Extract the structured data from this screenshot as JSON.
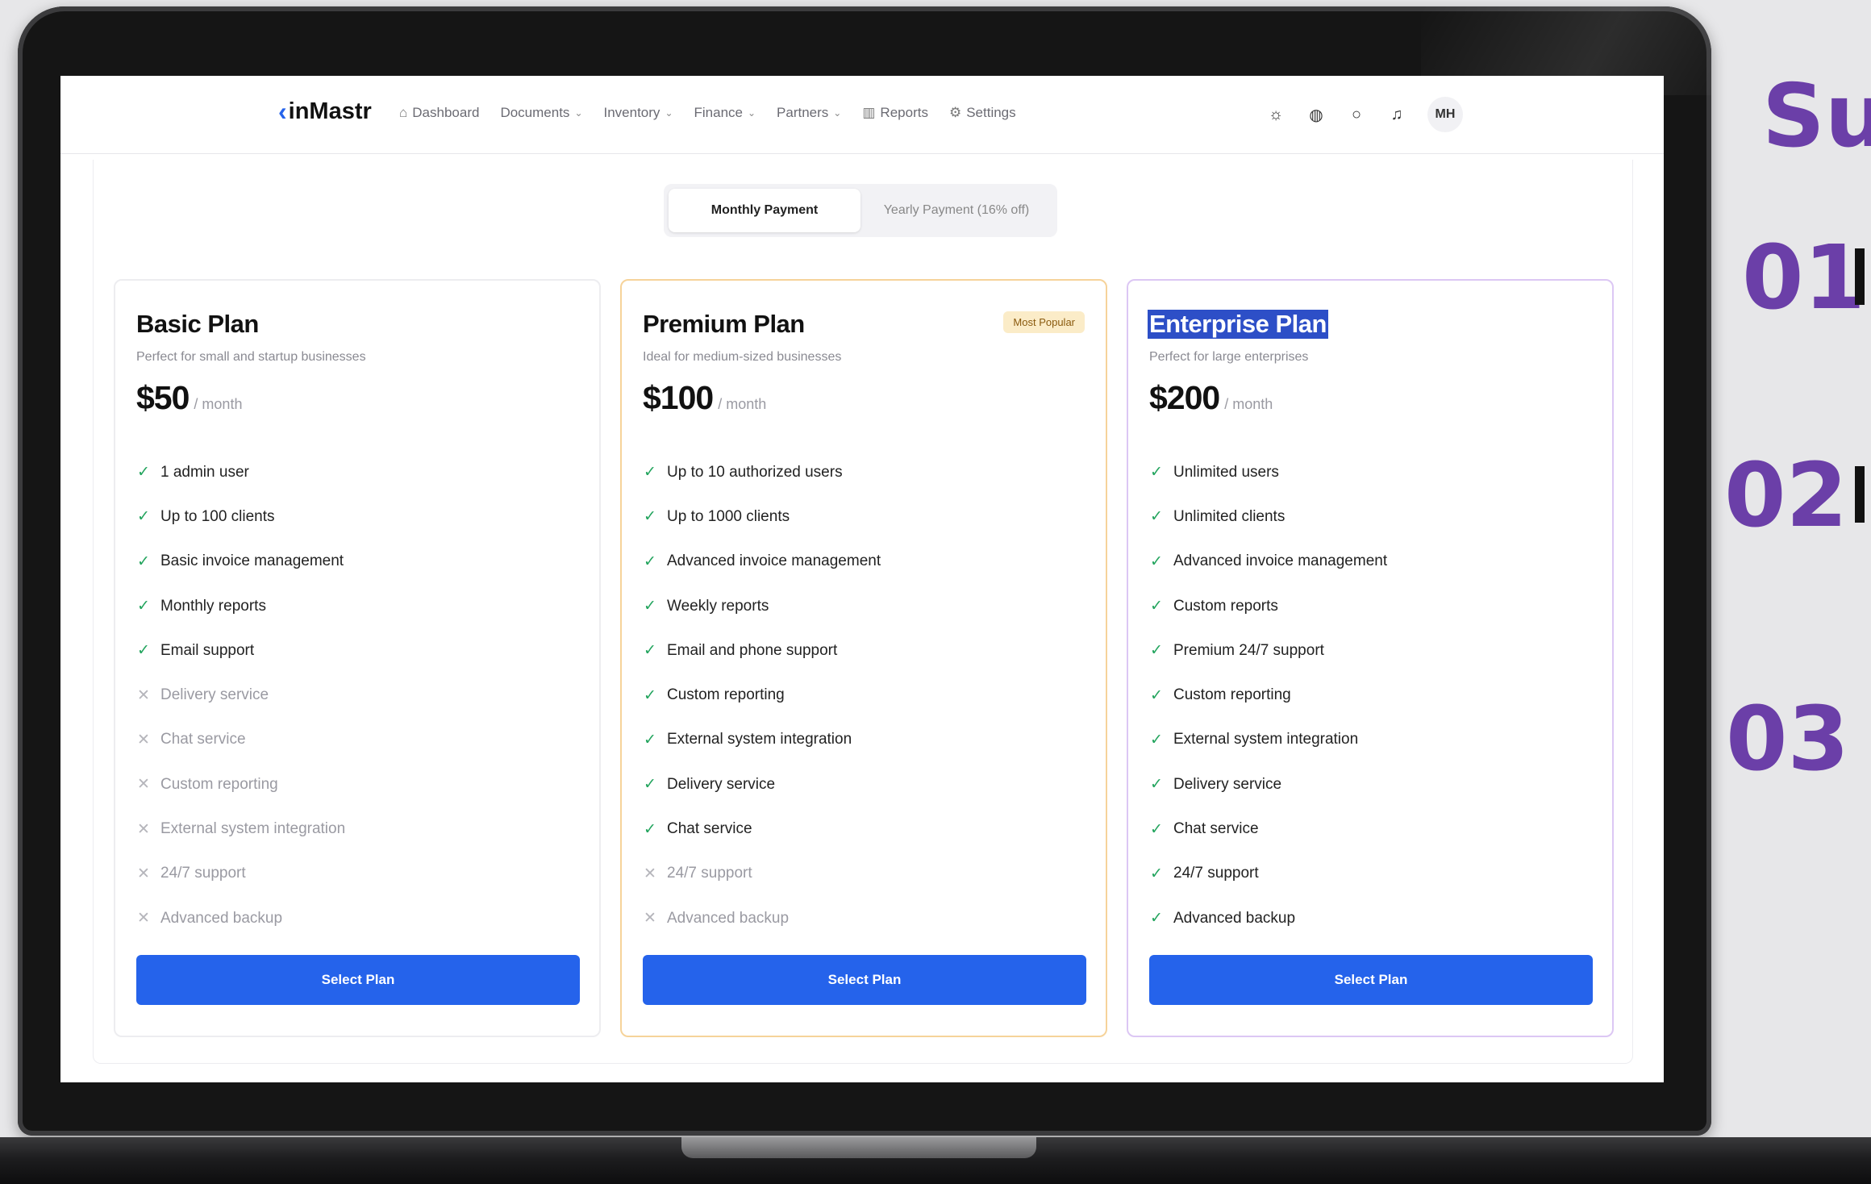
{
  "navbar": {
    "logo": "inMastr",
    "items": [
      {
        "label": "Dashboard",
        "icon": "home-icon",
        "dropdown": false
      },
      {
        "label": "Documents",
        "icon": "",
        "dropdown": true
      },
      {
        "label": "Inventory",
        "icon": "",
        "dropdown": true
      },
      {
        "label": "Finance",
        "icon": "",
        "dropdown": true
      },
      {
        "label": "Partners",
        "icon": "",
        "dropdown": true
      },
      {
        "label": "Reports",
        "icon": "chart-icon",
        "dropdown": false
      },
      {
        "label": "Settings",
        "icon": "gear-icon",
        "dropdown": false
      }
    ],
    "right_icons": [
      "theme-toggle-icon",
      "globe-icon",
      "chat-icon",
      "bell-icon"
    ],
    "avatar_initials": "MH"
  },
  "billing_toggle": {
    "monthly": "Monthly Payment",
    "yearly": "Yearly Payment (16% off)",
    "active": "monthly"
  },
  "plans": [
    {
      "name": "Basic Plan",
      "subtitle": "Perfect for small and startup businesses",
      "price": "$50",
      "period": "/ month",
      "badge": "",
      "features": [
        {
          "text": "1 admin user",
          "included": true
        },
        {
          "text": "Up to 100 clients",
          "included": true
        },
        {
          "text": "Basic invoice management",
          "included": true
        },
        {
          "text": "Monthly reports",
          "included": true
        },
        {
          "text": "Email support",
          "included": true
        },
        {
          "text": "Delivery service",
          "included": false
        },
        {
          "text": "Chat service",
          "included": false
        },
        {
          "text": "Custom reporting",
          "included": false
        },
        {
          "text": "External system integration",
          "included": false
        },
        {
          "text": "24/7 support",
          "included": false
        },
        {
          "text": "Advanced backup",
          "included": false
        }
      ],
      "button": "Select Plan"
    },
    {
      "name": "Premium Plan",
      "subtitle": "Ideal for medium-sized businesses",
      "price": "$100",
      "period": "/ month",
      "badge": "Most Popular",
      "features": [
        {
          "text": "Up to 10 authorized users",
          "included": true
        },
        {
          "text": "Up to 1000 clients",
          "included": true
        },
        {
          "text": "Advanced invoice management",
          "included": true
        },
        {
          "text": "Weekly reports",
          "included": true
        },
        {
          "text": "Email and phone support",
          "included": true
        },
        {
          "text": "Custom reporting",
          "included": true
        },
        {
          "text": "External system integration",
          "included": true
        },
        {
          "text": "Delivery service",
          "included": true
        },
        {
          "text": "Chat service",
          "included": true
        },
        {
          "text": "24/7 support",
          "included": false
        },
        {
          "text": "Advanced backup",
          "included": false
        }
      ],
      "button": "Select Plan"
    },
    {
      "name": "Enterprise Plan",
      "subtitle": "Perfect for large enterprises",
      "price": "$200",
      "period": "/ month",
      "badge": "",
      "features": [
        {
          "text": "Unlimited users",
          "included": true
        },
        {
          "text": "Unlimited clients",
          "included": true
        },
        {
          "text": "Advanced invoice management",
          "included": true
        },
        {
          "text": "Custom reports",
          "included": true
        },
        {
          "text": "Premium 24/7 support",
          "included": true
        },
        {
          "text": "Custom reporting",
          "included": true
        },
        {
          "text": "External system integration",
          "included": true
        },
        {
          "text": "Delivery service",
          "included": true
        },
        {
          "text": "Chat service",
          "included": true
        },
        {
          "text": "24/7 support",
          "included": true
        },
        {
          "text": "Advanced backup",
          "included": true
        }
      ],
      "button": "Select Plan"
    }
  ],
  "side_panel": {
    "heading": "Su",
    "numbers": [
      "01",
      "02",
      "03"
    ]
  },
  "colors": {
    "accent": "#2563eb",
    "check": "#22a45d",
    "premium_border": "#f6d39a",
    "enterprise_border": "#dcc7f4",
    "side_text": "#6b3fa8"
  }
}
